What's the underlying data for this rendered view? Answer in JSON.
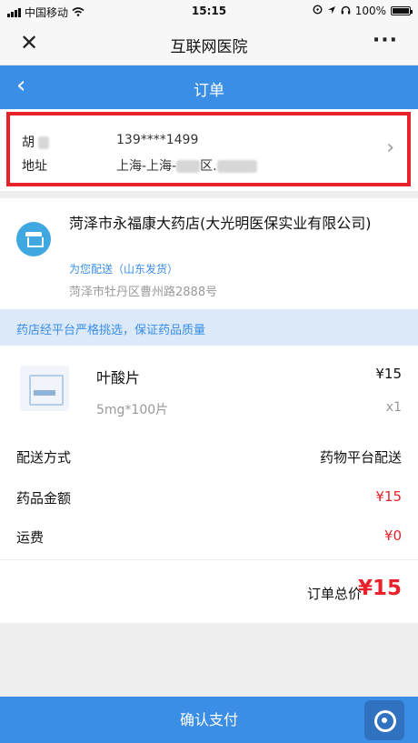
{
  "status_bar": {
    "carrier": "中国移动",
    "time": "15:15",
    "battery": "100%"
  },
  "wx_header": {
    "close_icon": "close-icon",
    "title": "互联网医院",
    "more_icon": "more-icon"
  },
  "nav": {
    "back_icon": "chevron-left-icon",
    "title": "订单"
  },
  "address": {
    "name": "胡",
    "phone": "139****1499",
    "label": "地址",
    "value_prefix": "上海-上海-",
    "value_mid": "区.",
    "chevron_icon": "chevron-right-icon"
  },
  "store": {
    "icon": "store-icon",
    "name": "菏泽市永福康大药店(大光明医保实业有限公司)",
    "delivery": "为您配送（山东发货）",
    "address": "菏泽市牡丹区曹州路2888号"
  },
  "notice": "药店经平台严格挑选，保证药品质量",
  "medicine": {
    "name": "叶酸片",
    "price": "¥15",
    "spec": "5mg*100片",
    "qty": "x1"
  },
  "rows": {
    "delivery_label": "配送方式",
    "delivery_value": "药物平台配送",
    "amount_label": "药品金额",
    "amount_value": "¥15",
    "shipping_label": "运费",
    "shipping_value": "¥0"
  },
  "total": {
    "label": "订单总价",
    "value": "¥15"
  },
  "pay": {
    "button": "确认支付",
    "fab_icon": "settings-icon"
  },
  "colors": {
    "accent": "#3a8ee6",
    "price_red": "#e8212a",
    "highlight_border": "#e8212a",
    "notice_bg": "#dce9f9"
  }
}
